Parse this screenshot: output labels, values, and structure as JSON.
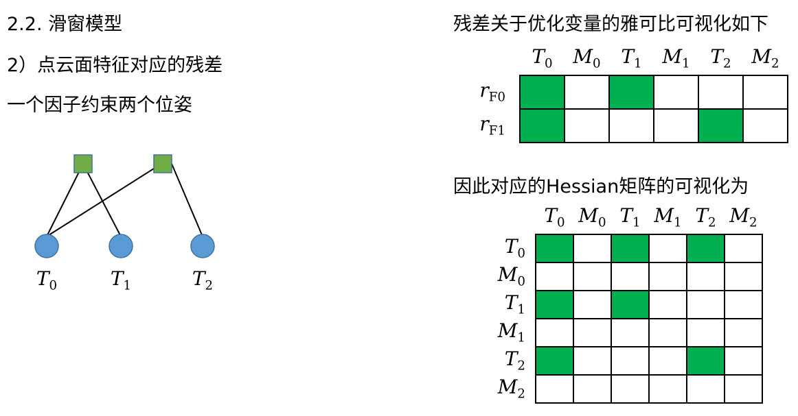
{
  "left": {
    "section_title": "2.2. 滑窗模型",
    "subtitle": "2）点云面特征对应的残差",
    "note": "一个因子约束两个位姿"
  },
  "graph": {
    "factor_color": "#70AD47",
    "node_color": "#5B9BD5",
    "factors": [
      "f0",
      "f1"
    ],
    "nodes": [
      {
        "name": "T",
        "sub": "0"
      },
      {
        "name": "T",
        "sub": "1"
      },
      {
        "name": "T",
        "sub": "2"
      }
    ],
    "edges": [
      [
        "f0",
        0
      ],
      [
        "f0",
        1
      ],
      [
        "f1",
        0
      ],
      [
        "f1",
        2
      ]
    ]
  },
  "jacobian": {
    "title": "残差关于优化变量的雅可比可视化如下",
    "columns": [
      {
        "name": "T",
        "sub": "0"
      },
      {
        "name": "M",
        "sub": "0"
      },
      {
        "name": "T",
        "sub": "1"
      },
      {
        "name": "M",
        "sub": "1"
      },
      {
        "name": "T",
        "sub": "2"
      },
      {
        "name": "M",
        "sub": "2"
      }
    ],
    "rows": [
      {
        "name": "r",
        "sub": "F0"
      },
      {
        "name": "r",
        "sub": "F1"
      }
    ],
    "filled": [
      [
        1,
        0,
        1,
        0,
        0,
        0
      ],
      [
        1,
        0,
        0,
        0,
        1,
        0
      ]
    ]
  },
  "hessian": {
    "title": "因此对应的Hessian矩阵的可视化为",
    "columns": [
      {
        "name": "T",
        "sub": "0"
      },
      {
        "name": "M",
        "sub": "0"
      },
      {
        "name": "T",
        "sub": "1"
      },
      {
        "name": "M",
        "sub": "1"
      },
      {
        "name": "T",
        "sub": "2"
      },
      {
        "name": "M",
        "sub": "2"
      }
    ],
    "rows": [
      {
        "name": "T",
        "sub": "0"
      },
      {
        "name": "M",
        "sub": "0"
      },
      {
        "name": "T",
        "sub": "1"
      },
      {
        "name": "M",
        "sub": "1"
      },
      {
        "name": "T",
        "sub": "2"
      },
      {
        "name": "M",
        "sub": "2"
      }
    ],
    "filled": [
      [
        1,
        0,
        1,
        0,
        1,
        0
      ],
      [
        0,
        0,
        0,
        0,
        0,
        0
      ],
      [
        1,
        0,
        1,
        0,
        0,
        0
      ],
      [
        0,
        0,
        0,
        0,
        0,
        0
      ],
      [
        1,
        0,
        0,
        0,
        1,
        0
      ],
      [
        0,
        0,
        0,
        0,
        0,
        0
      ]
    ]
  },
  "colors": {
    "filled_cell": "#00B050",
    "empty_cell": "#ffffff",
    "grid_line": "#000000"
  }
}
